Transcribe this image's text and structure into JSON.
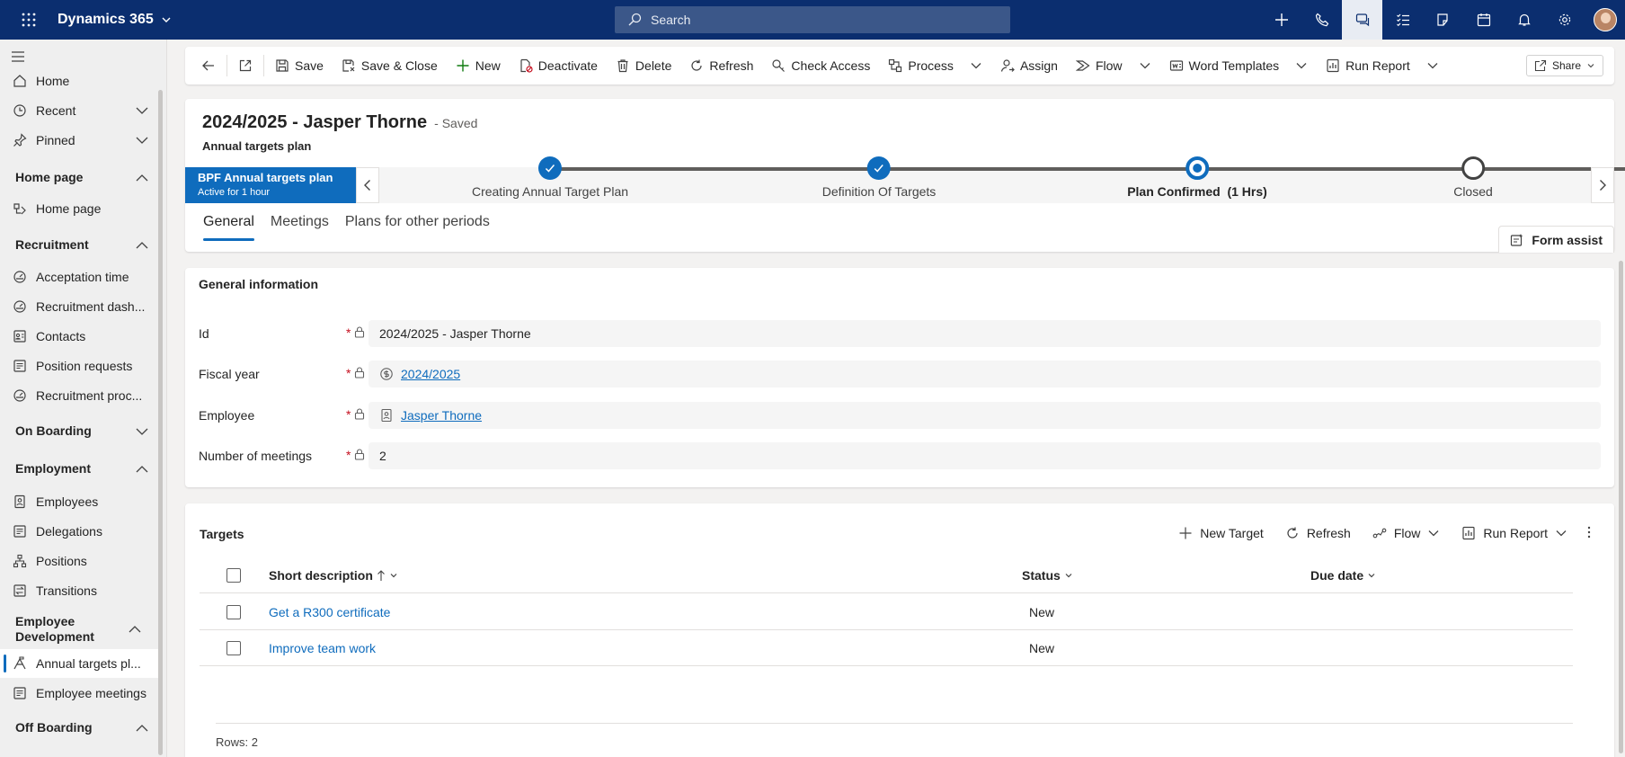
{
  "app": {
    "title": "Dynamics 365",
    "search_placeholder": "Search"
  },
  "sidebar": {
    "items_top": [
      {
        "label": "Home",
        "icon": "home-icon"
      },
      {
        "label": "Recent",
        "icon": "clock-icon",
        "expandable": true
      },
      {
        "label": "Pinned",
        "icon": "pin-icon",
        "expandable": true
      }
    ],
    "groups": [
      {
        "label": "Home page",
        "items": [
          "Home page"
        ]
      },
      {
        "label": "Recruitment",
        "items": [
          "Acceptation time",
          "Recruitment dash...",
          "Contacts",
          "Position requests",
          "Recruitment proc..."
        ]
      },
      {
        "label": "On Boarding",
        "items": []
      },
      {
        "label": "Employment",
        "items": [
          "Employees",
          "Delegations",
          "Positions",
          "Transitions"
        ]
      },
      {
        "label": "Employee Development",
        "items": [
          "Annual targets pl...",
          "Employee meetings"
        ]
      },
      {
        "label": "Off Boarding",
        "items": []
      }
    ],
    "selected": "Annual targets pl..."
  },
  "commandbar": {
    "save": "Save",
    "save_close": "Save & Close",
    "new": "New",
    "deactivate": "Deactivate",
    "delete": "Delete",
    "refresh": "Refresh",
    "check_access": "Check Access",
    "process": "Process",
    "assign": "Assign",
    "flow": "Flow",
    "word_templates": "Word Templates",
    "run_report": "Run Report",
    "share": "Share"
  },
  "record": {
    "title": "2024/2025 - Jasper Thorne",
    "status": "- Saved",
    "entity": "Annual targets plan"
  },
  "bpf": {
    "name": "BPF Annual targets plan",
    "active_for": "Active for 1 hour",
    "stages": [
      {
        "label": "Creating Annual Target Plan",
        "state": "done"
      },
      {
        "label": "Definition Of Targets",
        "state": "done"
      },
      {
        "label": "Plan Confirmed",
        "duration": "(1 Hrs)",
        "state": "active"
      },
      {
        "label": "Closed",
        "state": "todo"
      }
    ]
  },
  "tabs": [
    "General",
    "Meetings",
    "Plans for other periods"
  ],
  "form_assist": "Form assist",
  "general": {
    "title": "General information",
    "fields": [
      {
        "label": "Id",
        "value": "2024/2025 - Jasper Thorne",
        "required": "*"
      },
      {
        "label": "Fiscal year",
        "value": "2024/2025",
        "required": "*",
        "link": true
      },
      {
        "label": "Employee",
        "value": "Jasper Thorne",
        "required": "*",
        "link": true
      },
      {
        "label": "Number of meetings",
        "value": "2",
        "required": "*"
      }
    ]
  },
  "targets": {
    "title": "Targets",
    "commands": {
      "new_target": "New Target",
      "refresh": "Refresh",
      "flow": "Flow",
      "run_report": "Run Report"
    },
    "columns": {
      "short_description": "Short description",
      "status": "Status",
      "due_date": "Due date"
    },
    "rows": [
      {
        "short_description": "Get a R300 certificate",
        "status": "New",
        "due_date": ""
      },
      {
        "short_description": "Improve team work",
        "status": "New",
        "due_date": ""
      }
    ],
    "rows_count": "Rows: 2"
  }
}
